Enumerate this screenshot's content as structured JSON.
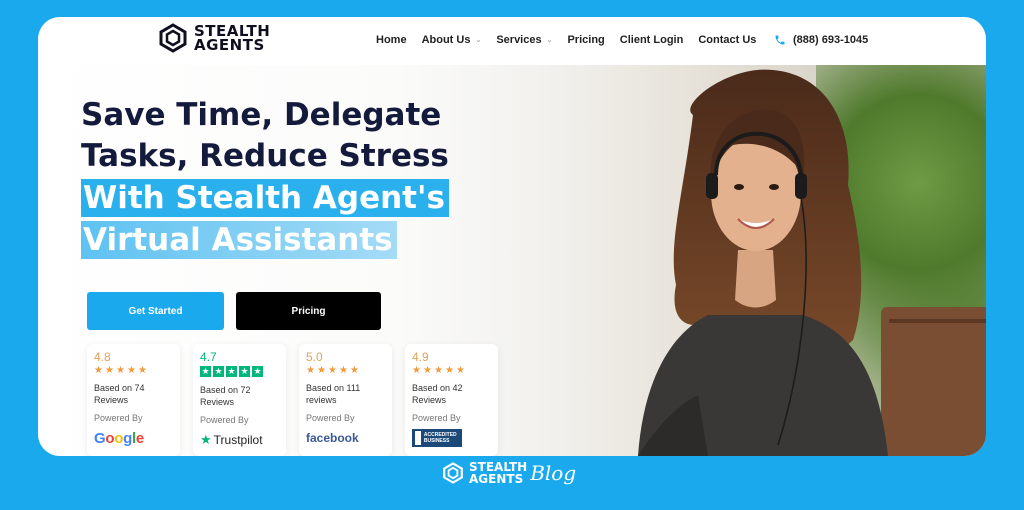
{
  "header": {
    "logo_line1": "STEALTH",
    "logo_line2": "AGENTS",
    "nav": [
      {
        "label": "Home",
        "has_dropdown": false
      },
      {
        "label": "About Us",
        "has_dropdown": true
      },
      {
        "label": "Services",
        "has_dropdown": true
      },
      {
        "label": "Pricing",
        "has_dropdown": false
      },
      {
        "label": "Client Login",
        "has_dropdown": false
      },
      {
        "label": "Contact Us",
        "has_dropdown": false
      }
    ],
    "phone": "(888) 693-1045",
    "phone_icon": "phone-icon"
  },
  "hero": {
    "line1": "Save Time, Delegate",
    "line2": "Tasks, Reduce Stress",
    "line3": " With Stealth Agent's",
    "line4": "Virtual Assistants",
    "cta_primary": "Get Started",
    "cta_secondary": "Pricing"
  },
  "reviews": [
    {
      "score": "4.8",
      "based": "Based on 74 Reviews",
      "powered": "Powered By",
      "brand": "Google"
    },
    {
      "score": "4.7",
      "based": "Based on 72 Reviews",
      "powered": "Powered By",
      "brand": "Trustpilot"
    },
    {
      "score": "5.0",
      "based": "Based on 111 reviews",
      "powered": "Powered By",
      "brand": "facebook"
    },
    {
      "score": "4.9",
      "based": "Based on 42 Reviews",
      "powered": "Powered By",
      "brand": "ACCREDITED BUSINESS"
    }
  ],
  "footer": {
    "line1": "STEALTH",
    "line2": "AGENTS",
    "script": "Blog"
  },
  "colors": {
    "accent": "#1aa9ec",
    "headline": "#141a3c",
    "star": "#f39a3a",
    "trustpilot": "#00b67a"
  }
}
